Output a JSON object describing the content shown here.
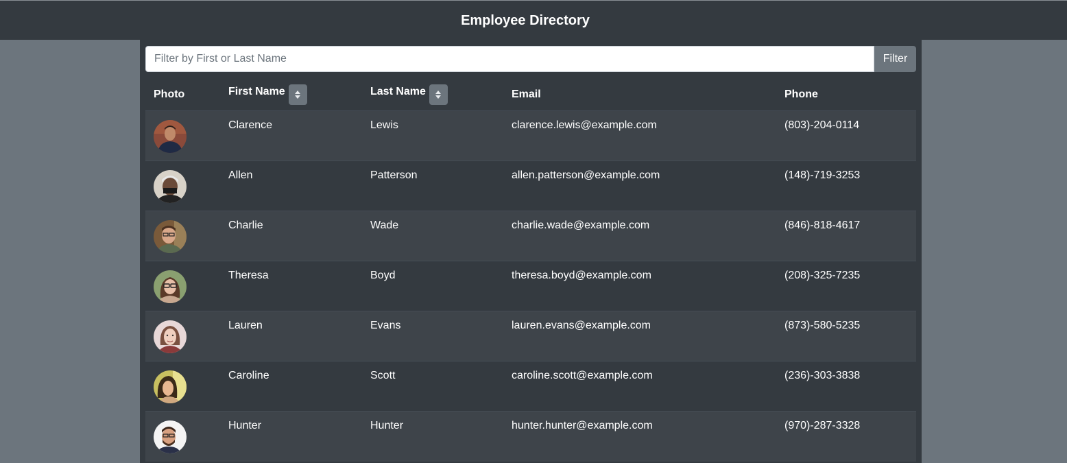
{
  "header": {
    "title": "Employee Directory"
  },
  "filter": {
    "placeholder": "Filter by First or Last Name",
    "value": "",
    "button_label": "Filter"
  },
  "table": {
    "columns": {
      "photo": "Photo",
      "first_name": "First Name",
      "last_name": "Last Name",
      "email": "Email",
      "phone": "Phone"
    },
    "rows": [
      {
        "first": "Clarence",
        "last": "Lewis",
        "email": "clarence.lewis@example.com",
        "phone": "(803)-204-0114"
      },
      {
        "first": "Allen",
        "last": "Patterson",
        "email": "allen.patterson@example.com",
        "phone": "(148)-719-3253"
      },
      {
        "first": "Charlie",
        "last": "Wade",
        "email": "charlie.wade@example.com",
        "phone": "(846)-818-4617"
      },
      {
        "first": "Theresa",
        "last": "Boyd",
        "email": "theresa.boyd@example.com",
        "phone": "(208)-325-7235"
      },
      {
        "first": "Lauren",
        "last": "Evans",
        "email": "lauren.evans@example.com",
        "phone": "(873)-580-5235"
      },
      {
        "first": "Caroline",
        "last": "Scott",
        "email": "caroline.scott@example.com",
        "phone": "(236)-303-3838"
      },
      {
        "first": "Hunter",
        "last": "Hunter",
        "email": "hunter.hunter@example.com",
        "phone": "(970)-287-3328"
      }
    ]
  },
  "colors": {
    "page_background": "#6c757d",
    "header_background": "#343a40",
    "table_background": "#343a40",
    "striped_row": "#3e444a",
    "button": "#6c757d",
    "text": "#ffffff"
  }
}
